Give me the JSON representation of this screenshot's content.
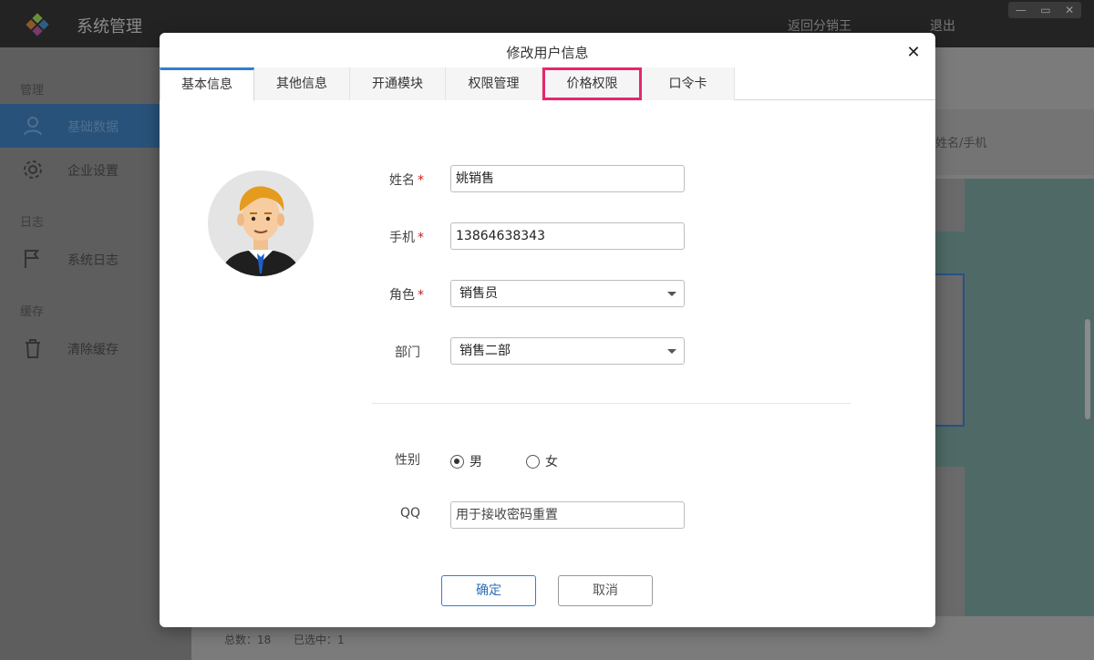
{
  "app": {
    "title": "系统管理",
    "top_links": [
      "返回分销王",
      "退出"
    ],
    "window_controls": [
      "—",
      "▭",
      "✕"
    ]
  },
  "sidebar": {
    "groups": [
      {
        "label": "管理",
        "items": [
          {
            "label": "基础数据",
            "icon": "user-icon",
            "active": true
          },
          {
            "label": "企业设置",
            "icon": "gear-icon",
            "active": false
          }
        ]
      },
      {
        "label": "日志",
        "items": [
          {
            "label": "系统日志",
            "icon": "flag-icon",
            "active": false
          }
        ]
      },
      {
        "label": "缓存",
        "items": [
          {
            "label": "清除缓存",
            "icon": "trash-icon",
            "active": false
          }
        ]
      }
    ]
  },
  "background": {
    "search_hint": "姓名/手机",
    "footer_total": "总数：18",
    "footer_selected": "已选中：1"
  },
  "modal": {
    "title": "修改用户信息",
    "close_icon": "close-icon",
    "tabs": [
      {
        "label": "基本信息",
        "active": true
      },
      {
        "label": "其他信息",
        "active": false
      },
      {
        "label": "开通模块",
        "active": false
      },
      {
        "label": "权限管理",
        "active": false
      },
      {
        "label": "价格权限",
        "active": false,
        "highlighted": true
      },
      {
        "label": "口令卡",
        "active": false
      }
    ],
    "form": {
      "name_label": "姓名",
      "name_value": "姚销售",
      "phone_label": "手机",
      "phone_value": "13864638343",
      "role_label": "角色",
      "role_value": "销售员",
      "dept_label": "部门",
      "dept_value": "销售二部",
      "required_mark": "*",
      "gender_label": "性别",
      "gender_male": "男",
      "gender_female": "女",
      "gender_selected": "男",
      "qq_label": "QQ",
      "qq_placeholder": "用于接收密码重置"
    },
    "buttons": {
      "ok": "确定",
      "cancel": "取消"
    },
    "colors": {
      "accent": "#2f7fd4",
      "highlight": "#e6266f",
      "required": "#c6221c"
    }
  }
}
